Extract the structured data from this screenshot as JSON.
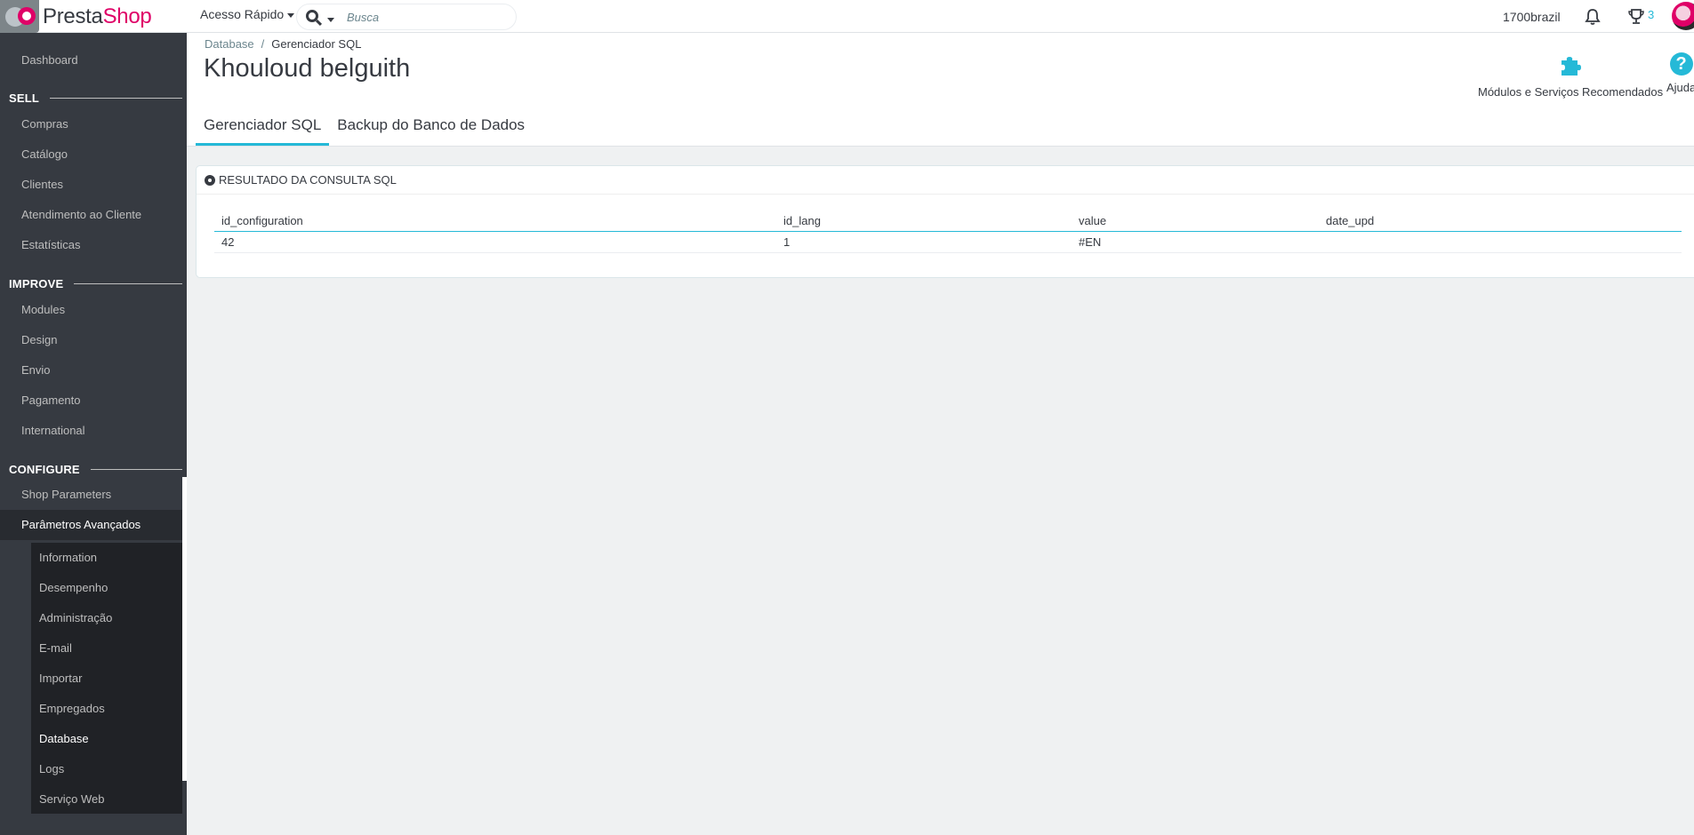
{
  "topbar": {
    "brand_part1": "Presta",
    "brand_part2": "Shop",
    "quick_access": "Acesso Rápido",
    "search_placeholder": "Busca",
    "shop_name": "1700brazil",
    "trophy_count": "3"
  },
  "sidebar": {
    "dashboard": "Dashboard",
    "section_sell": "SELL",
    "sell_items": [
      "Compras",
      "Catálogo",
      "Clientes",
      "Atendimento ao Cliente",
      "Estatísticas"
    ],
    "section_improve": "IMPROVE",
    "improve_items": [
      "Modules",
      "Design",
      "Envio",
      "Pagamento",
      "International"
    ],
    "section_configure": "CONFIGURE",
    "configure_items": [
      "Shop Parameters",
      "Parâmetros Avançados"
    ],
    "sub_items": [
      "Information",
      "Desempenho",
      "Administração",
      "E-mail",
      "Importar",
      "Empregados",
      "Database",
      "Logs",
      "Serviço Web"
    ]
  },
  "header": {
    "breadcrumb_parent": "Database",
    "breadcrumb_separator": "/",
    "breadcrumb_current": "Gerenciador SQL",
    "title": "Khouloud belguith",
    "toolbar_modules": "Módulos e Serviços Recomendados",
    "toolbar_help": "Ajuda",
    "tabs": [
      "Gerenciador SQL",
      "Backup do Banco de Dados"
    ]
  },
  "panel": {
    "title": "Resultado da consulta SQL",
    "columns": [
      "id_configuration",
      "id_lang",
      "value",
      "date_upd"
    ],
    "rows": [
      [
        "42",
        "1",
        "#EN",
        ""
      ]
    ]
  },
  "colors": {
    "accent": "#25b9d7",
    "brand_pink": "#df0067",
    "sidebar_bg": "#363a41"
  }
}
